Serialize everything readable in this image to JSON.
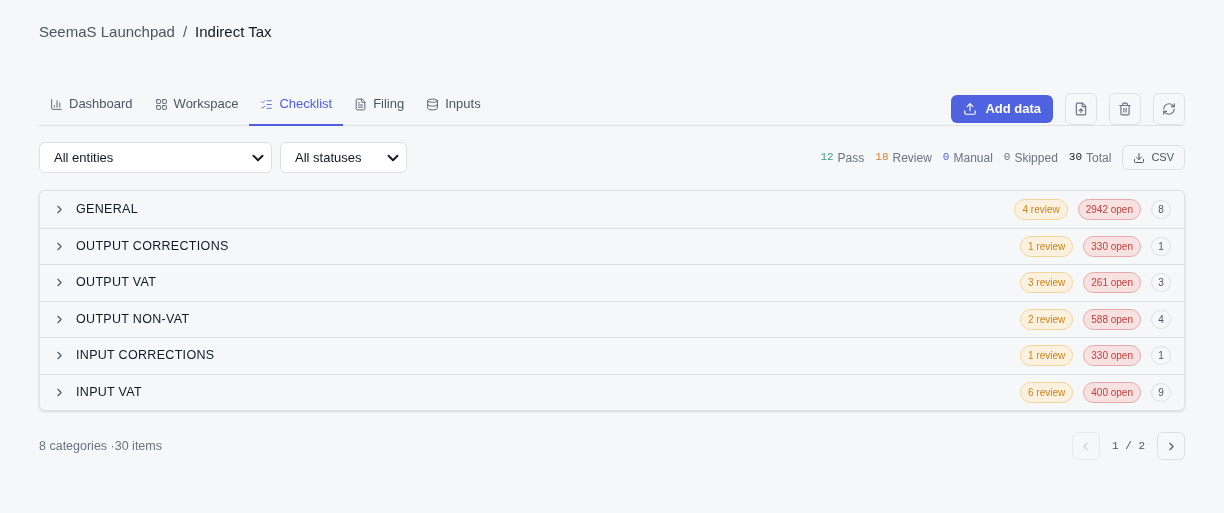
{
  "breadcrumb": {
    "parent": "SeemaS Launchpad",
    "separator": "/",
    "current": "Indirect Tax"
  },
  "tabs": [
    {
      "label": "Dashboard",
      "selected": false
    },
    {
      "label": "Workspace",
      "selected": false
    },
    {
      "label": "Checklist",
      "selected": true
    },
    {
      "label": "Filing",
      "selected": false
    },
    {
      "label": "Inputs",
      "selected": false
    }
  ],
  "add_button": "Add data",
  "filters": [
    {
      "value": "All entities"
    },
    {
      "value": "All statuses"
    }
  ],
  "stats": [
    {
      "kind": "pass",
      "count": "12",
      "label": "Pass"
    },
    {
      "kind": "review",
      "count": "18",
      "label": "Review"
    },
    {
      "kind": "manual",
      "count": "0",
      "label": "Manual"
    },
    {
      "kind": "skipped",
      "count": "0",
      "label": "Skipped"
    },
    {
      "kind": "total",
      "count": "30",
      "label": "Total"
    }
  ],
  "csv_button": "CSV",
  "categories": [
    {
      "name": "GENERAL",
      "expanded": false,
      "review": "4 review",
      "open": "2942 open",
      "count": "8"
    },
    {
      "name": "OUTPUT CORRECTIONS",
      "expanded": false,
      "review": "1 review",
      "open": "330 open",
      "count": "1"
    },
    {
      "name": "OUTPUT VAT",
      "expanded": false,
      "review": "3 review",
      "open": "261 open",
      "count": "3"
    },
    {
      "name": "OUTPUT NON-VAT",
      "expanded": false,
      "review": "2 review",
      "open": "588 open",
      "count": "4"
    },
    {
      "name": "INPUT CORRECTIONS",
      "expanded": false,
      "review": "1 review",
      "open": "330 open",
      "count": "1"
    },
    {
      "name": "INPUT VAT",
      "expanded": false,
      "review": "6 review",
      "open": "400 open",
      "count": "9"
    }
  ],
  "footer": {
    "summary": "8 categories ·30 items",
    "page": "1 / 2",
    "prev_disabled": true,
    "next_disabled": false
  }
}
